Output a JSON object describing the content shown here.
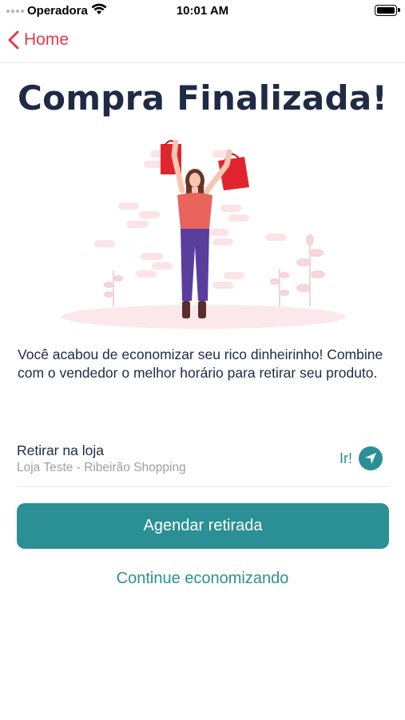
{
  "status_bar": {
    "carrier": "Operadora",
    "time": "10:01 AM"
  },
  "nav": {
    "back_label": "Home"
  },
  "title": "Compra Finalizada!",
  "message": "Você acabou de economizar seu rico dinheirinho! Combine com o vendedor o melhor horário para  retirar seu produto.",
  "pickup": {
    "title": "Retirar na loja",
    "store": "Loja Teste - Ribeirão Shopping",
    "go_label": "Ir!"
  },
  "buttons": {
    "schedule": "Agendar retirada",
    "continue": "Continue economizando"
  },
  "colors": {
    "accent": "#2a9096",
    "back": "#e53a48",
    "title": "#1f2a44",
    "bag": "#e0252f"
  }
}
